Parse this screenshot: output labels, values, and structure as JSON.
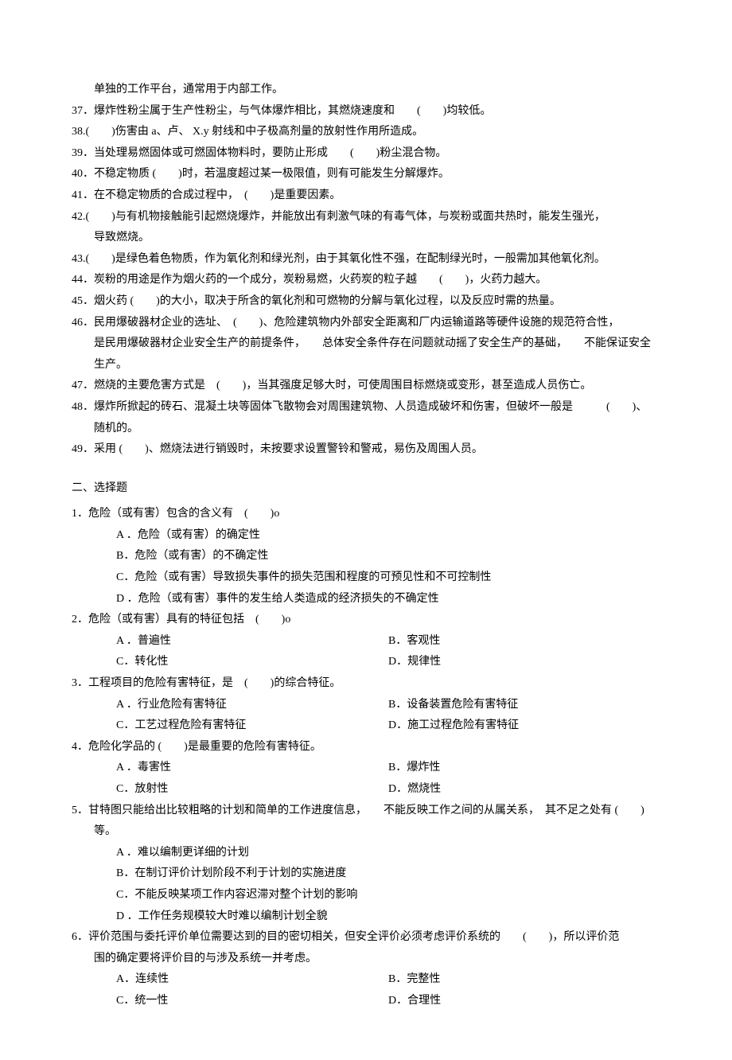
{
  "fill": {
    "cont36": "单独的工作平台，通常用于内部工作。",
    "37": "37．爆炸性粉尘属于生产性粉尘，与气体爆炸相比，其燃烧速度和　　(　　)均较低。",
    "38": "38.(　　)伤害由 a、卢、 X.y 射线和中子极高剂量的放射性作用所造成。",
    "39": "39．当处理易燃固体或可燃固体物料时，要防止形成　　(　　)粉尘混合物。",
    "40": "40．不稳定物质 (　　)时，若温度超过某一极限值，则有可能发生分解爆炸。",
    "41": "41．在不稳定物质的合成过程中，　(　　)是重要因素。",
    "42a": "42.(　　)与有机物接触能引起燃烧爆炸，并能放出有刺激气味的有毒气体，与炭粉或面共热时，能发生强光，",
    "42b": "导致燃烧。",
    "43": "43.(　　)是绿色着色物质，作为氧化剂和绿光剂，由于其氧化性不强，在配制绿光时，一般需加其他氧化剂。",
    "44": "44．炭粉的用途是作为烟火药的一个成分，炭粉易燃，火药炭的粒子越　　(　　)，火药力越大。",
    "45": "45．烟火药 (　　)的大小，取决于所含的氧化剂和可燃物的分解与氧化过程，以及反应时需的热量。",
    "46a": "46．民用爆破器材企业的选址、　(　　)、危险建筑物内外部安全距离和厂内运输道路等硬件设施的规范符合性，",
    "46b": "是民用爆破器材企业安全生产的前提条件，　　总体安全条件存在问题就动摇了安全生产的基础，　　不能保证安全",
    "46c": "生产。",
    "47": "47．燃烧的主要危害方式是　(　　)，当其强度足够大时，可使周围目标燃烧或变形，甚至造成人员伤亡。",
    "48a": "48．爆炸所掀起的砖石、混凝土块等固体飞散物会对周围建筑物、人员造成破坏和伤害，但破坏一般是　　　(　　)、",
    "48b": "随机的。",
    "49": "49．采用 (　　)、燃烧法进行销毁时，未按要求设置警铃和警戒，易伤及周围人员。"
  },
  "choice": {
    "title": "二、选择题",
    "q1": {
      "stem": "1．危险（或有害）包含的含义有　(　　)o",
      "A": "A ．危险（或有害）的确定性",
      "B": "B．危险（或有害）的不确定性",
      "C": "C．危险（或有害）导致损失事件的损失范围和程度的可预见性和不可控制性",
      "D": "D ．危险（或有害）事件的发生给人类造成的经济损失的不确定性"
    },
    "q2": {
      "stem": "2．危险（或有害）具有的特征包括　(　　)o",
      "A": "A ．普遍性",
      "B": "B．客观性",
      "C": "C．转化性",
      "D": "D．规律性"
    },
    "q3": {
      "stem": "3．工程项目的危险有害特征，是　(　　)的综合特征。",
      "A": "A ．行业危险有害特征",
      "B": "B．设备装置危险有害特征",
      "C": "C．工艺过程危险有害特征",
      "D": "D．施工过程危险有害特征"
    },
    "q4": {
      "stem": "4．危险化学品的 (　　)是最重要的危险有害特征。",
      "A": "A ．毒害性",
      "B": "B．爆炸性",
      "C": "C．放射性",
      "D": "D．燃烧性"
    },
    "q5": {
      "stem": "5．甘特图只能给出比较粗略的计划和简单的工作进度信息，　　不能反映工作之间的从属关系，　其不足之处有  (　　)",
      "stem2": "等。",
      "A": "A ．难以编制更详细的计划",
      "B": "B．在制订评价计划阶段不利于计划的实施进度",
      "C": "C．不能反映某项工作内容迟滞对整个计划的影响",
      "D": "D ．工作任务规模较大时难以编制计划全貌"
    },
    "q6": {
      "stem": "6．评价范围与委托评价单位需要达到的目的密切相关，但安全评价必须考虑评价系统的　　(　　)，所以评价范",
      "stem2": "围的确定要将评价目的与涉及系统一并考虑。",
      "A": "A．连续性",
      "B": "B．完整性",
      "C": "C．统一性",
      "D": "D．合理性"
    }
  }
}
